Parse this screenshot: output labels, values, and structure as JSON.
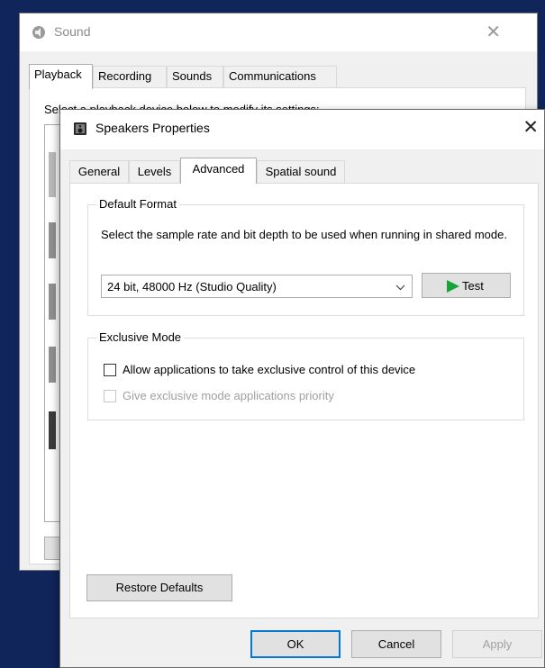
{
  "sound_window": {
    "title": "Sound",
    "close_glyph": "✕",
    "tabs": [
      {
        "label": "Playback",
        "active": true
      },
      {
        "label": "Recording",
        "active": false
      },
      {
        "label": "Sounds",
        "active": false
      },
      {
        "label": "Communications",
        "active": false
      }
    ],
    "instruction": "Select a playback device below to modify its settings:"
  },
  "dialog": {
    "title": "Speakers Properties",
    "close_glyph": "✕",
    "tabs": [
      {
        "label": "General",
        "active": false
      },
      {
        "label": "Levels",
        "active": false
      },
      {
        "label": "Advanced",
        "active": true
      },
      {
        "label": "Spatial sound",
        "active": false
      }
    ],
    "default_format": {
      "legend": "Default Format",
      "description": "Select the sample rate and bit depth to be used when running in shared mode.",
      "selected_format": "24 bit, 48000 Hz (Studio Quality)",
      "test_label": "Test"
    },
    "exclusive_mode": {
      "legend": "Exclusive Mode",
      "allow_exclusive": {
        "label": "Allow applications to take exclusive control of this device",
        "checked": false,
        "enabled": true
      },
      "give_priority": {
        "label": "Give exclusive mode applications priority",
        "checked": false,
        "enabled": false
      }
    },
    "restore_defaults_label": "Restore Defaults",
    "buttons": {
      "ok": "OK",
      "cancel": "Cancel",
      "apply": "Apply"
    }
  },
  "icons": {
    "speaker": "speaker-icon",
    "play": "play-icon",
    "dropdown": "chevron-down-icon"
  },
  "colors": {
    "desktop_background": "#10255a",
    "play_green": "#16a33a",
    "accent_blue": "#0078d7"
  }
}
